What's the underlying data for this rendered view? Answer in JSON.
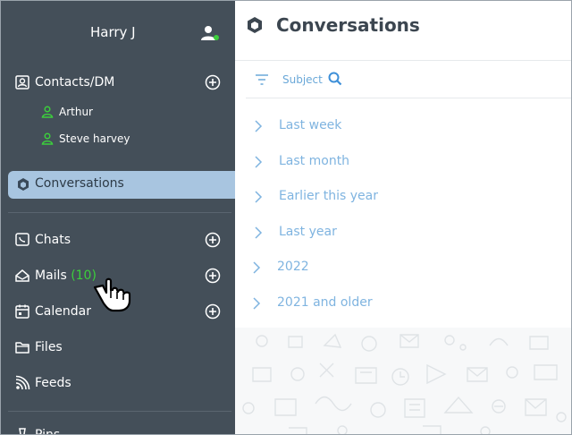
{
  "sidebar": {
    "user_name": "Harry J",
    "contacts": {
      "label": "Contacts/DM",
      "people": [
        {
          "name": "Arthur"
        },
        {
          "name": "Steve harvey"
        }
      ]
    },
    "conversations_label": "Conversations",
    "chats_label": "Chats",
    "mails_label": "Mails",
    "mails_count": "(10)",
    "calendar_label": "Calendar",
    "files_label": "Files",
    "feeds_label": "Feeds",
    "pins_label": "Pins"
  },
  "main": {
    "title": "Conversations",
    "filter": {
      "subject_label": "Subject"
    },
    "groups": [
      {
        "label": "Last week"
      },
      {
        "label": "Last month"
      },
      {
        "label": "Earlier this year"
      },
      {
        "label": "Last year"
      },
      {
        "label": "2022"
      },
      {
        "label": "2021 and older"
      }
    ]
  },
  "colors": {
    "sidebar_bg": "#444f59",
    "active_bg": "#a8c5e0",
    "accent_blue": "#7fb4e0",
    "badge_green": "#3ccf3c"
  }
}
